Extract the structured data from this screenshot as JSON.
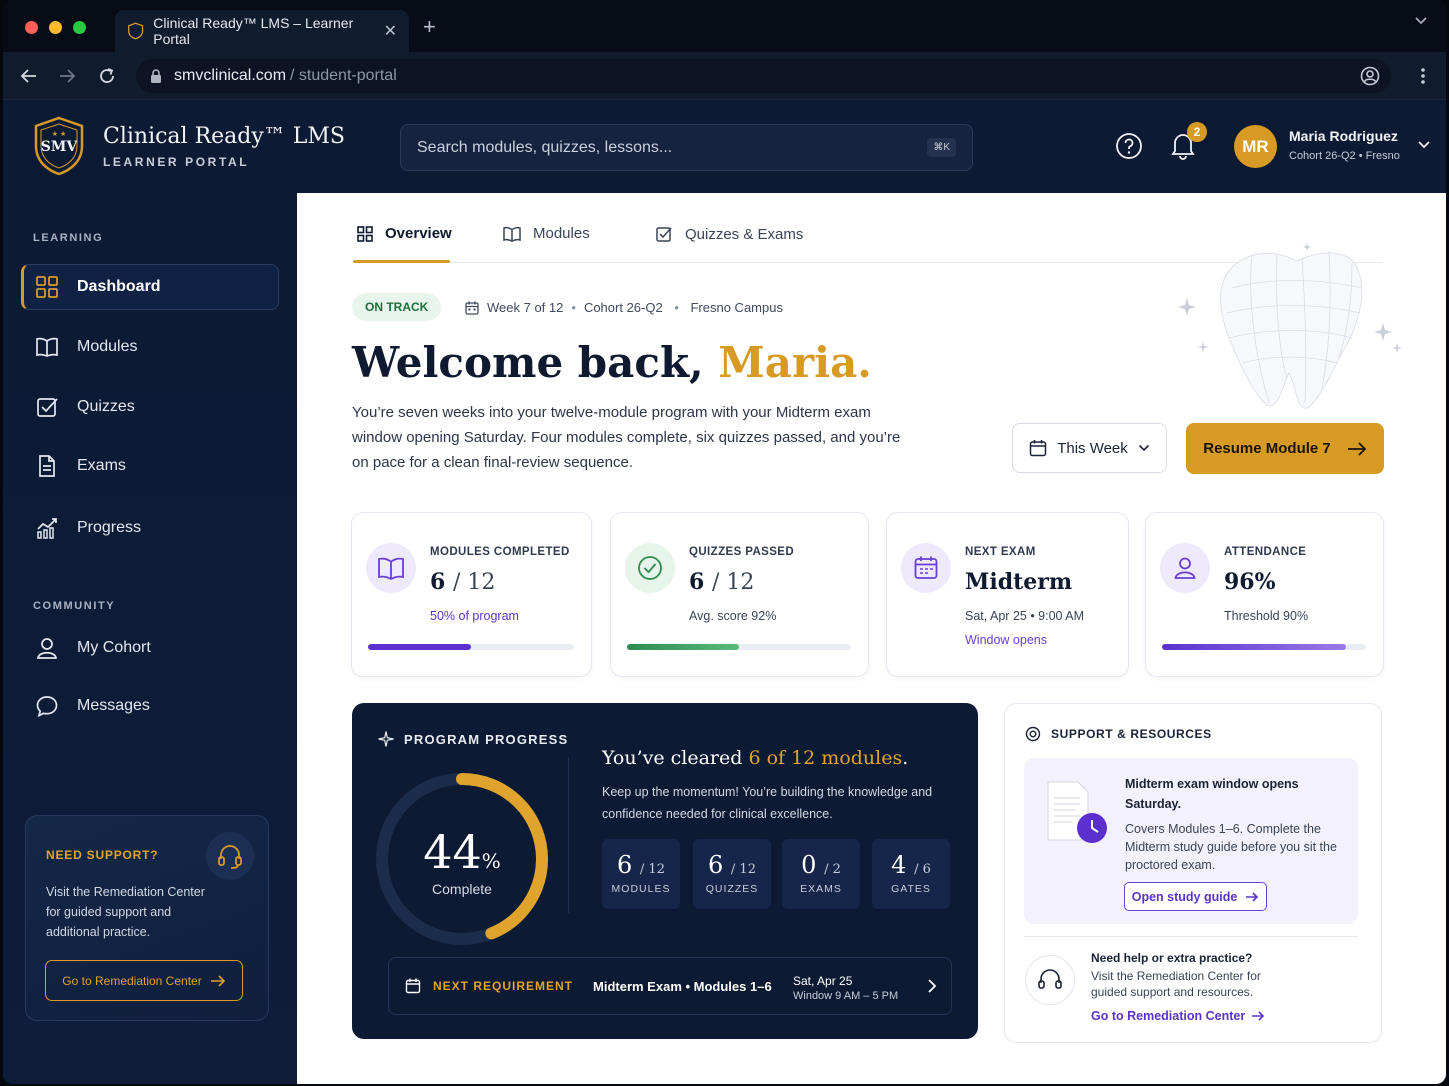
{
  "browser": {
    "tab_title": "Clinical Ready™ LMS – Learner Portal",
    "url_domain": "smvclinical.com",
    "url_path": "/ student-portal"
  },
  "header": {
    "crest_text": "SMV",
    "brand_name": "Clinical Ready™ LMS",
    "brand_sub": "LEARNER PORTAL",
    "search_placeholder": "Search modules, quizzes, lessons...",
    "search_shortcut": "⌘K",
    "notification_count": "2",
    "user_initials": "MR",
    "user_name": "Maria Rodriguez",
    "user_cohort": "Cohort 26-Q2 • Fresno"
  },
  "sidebar": {
    "learning_label": "LEARNING",
    "learning_items": [
      {
        "label": "Dashboard"
      },
      {
        "label": "Modules"
      },
      {
        "label": "Quizzes"
      },
      {
        "label": "Exams"
      },
      {
        "label": "Progress"
      }
    ],
    "community_label": "COMMUNITY",
    "community_items": [
      {
        "label": "My Cohort"
      },
      {
        "label": "Messages"
      }
    ],
    "support": {
      "title": "NEED SUPPORT?",
      "text": "Visit the Remediation Center for guided support and additional practice.",
      "button": "Go to Remediation Center"
    }
  },
  "main": {
    "tabs": [
      {
        "label": "Overview"
      },
      {
        "label": "Modules"
      },
      {
        "label": "Quizzes & Exams"
      }
    ],
    "status_pill": "ON TRACK",
    "meta_week": "Week 7 of 12",
    "meta_cohort": "Cohort 26-Q2",
    "meta_campus": "Fresno Campus",
    "welcome_prefix": "Welcome back,",
    "welcome_name": "Maria.",
    "intro": "You’re seven weeks into your twelve-module program with your Midterm exam window opening Saturday. Four modules complete, six quizzes passed, and you’re on pace for a clean final-review sequence.",
    "week_button": "This Week",
    "resume_button": "Resume Module 7"
  },
  "stats": {
    "modules": {
      "label": "MODULES COMPLETED",
      "value": "6",
      "total": "/ 12",
      "sub": "50% of program",
      "progress": 0.5
    },
    "quizzes": {
      "label": "QUIZZES PASSED",
      "value": "6",
      "total": "/ 12",
      "sub": "Avg. score  92%",
      "progress": 0.5
    },
    "exam": {
      "label": "NEXT EXAM",
      "value": "Midterm",
      "sub": "Sat, Apr 25 • 9:00 AM",
      "sub2": "Window opens"
    },
    "attendance": {
      "label": "ATTENDANCE",
      "value": "96%",
      "sub": "Threshold  90%",
      "progress": 0.9
    }
  },
  "program": {
    "title": "PROGRAM PROGRESS",
    "percent": "44",
    "percent_sign": "%",
    "percent_value": 0.44,
    "complete_label": "Complete",
    "headline_prefix": "You’ve cleared",
    "headline_highlight": "6 of 12 modules",
    "headline_suffix": ".",
    "description": "Keep up the momentum! You’re building the knowledge and confidence needed for clinical excellence.",
    "minis": [
      {
        "value": "6",
        "total": "/ 12",
        "label": "MODULES"
      },
      {
        "value": "6",
        "total": "/ 12",
        "label": "QUIZZES"
      },
      {
        "value": "0",
        "total": "/ 2",
        "label": "EXAMS"
      },
      {
        "value": "4",
        "total": "/ 6",
        "label": "GATES"
      }
    ],
    "next_label": "NEXT REQUIREMENT",
    "next_desc": "Midterm Exam • Modules 1–6",
    "next_date": "Sat, Apr 25",
    "next_window": "Window 9 AM – 5 PM"
  },
  "resources": {
    "title": "SUPPORT & RESOURCES",
    "card_heading": "Midterm exam window opens Saturday.",
    "card_text": "Covers Modules 1–6. Complete the Midterm study guide before you sit the proctored exam.",
    "card_button": "Open study guide",
    "help_q": "Need help or extra practice?",
    "help_text": "Visit the Remediation Center for guided support and resources.",
    "help_link": "Go to Remediation Center"
  },
  "colors": {
    "navy": "#0c1a33",
    "gold": "#d69a25",
    "purple": "#6a3fd6",
    "green": "#3a9b5c"
  }
}
